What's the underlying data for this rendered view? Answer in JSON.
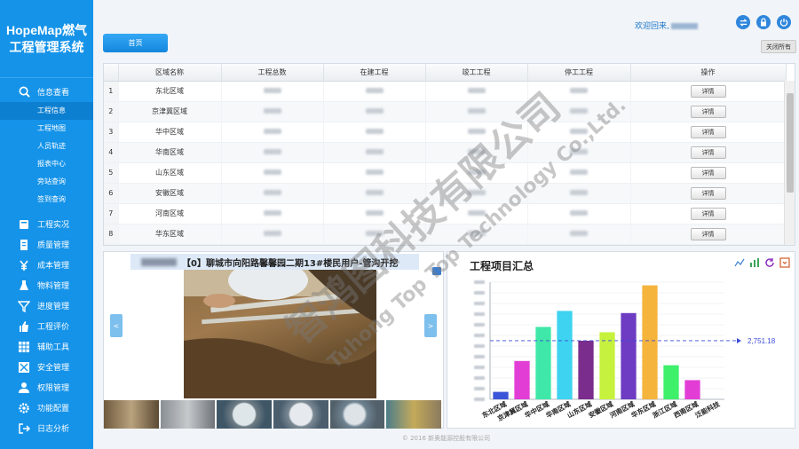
{
  "app": {
    "title_line1": "HopeMap燃气",
    "title_line2": "工程管理系统"
  },
  "sidebar": {
    "open_group": {
      "label": "信息查看",
      "icon": "search-icon"
    },
    "sub_items": [
      {
        "label": "工程信息",
        "active": true
      },
      {
        "label": "工程地图"
      },
      {
        "label": "人员轨迹"
      },
      {
        "label": "报表中心"
      },
      {
        "label": "旁站查询"
      },
      {
        "label": "签到查询"
      }
    ],
    "items": [
      {
        "label": "工程实况",
        "icon": "book-icon"
      },
      {
        "label": "质量管理",
        "icon": "document-icon"
      },
      {
        "label": "成本管理",
        "icon": "yen-icon"
      },
      {
        "label": "物料管理",
        "icon": "flask-icon"
      },
      {
        "label": "进度管理",
        "icon": "filter-icon"
      },
      {
        "label": "工程评价",
        "icon": "thumbs-up-icon"
      },
      {
        "label": "辅助工具",
        "icon": "grid-icon"
      },
      {
        "label": "安全管理",
        "icon": "shield-icon"
      },
      {
        "label": "权限管理",
        "icon": "user-icon"
      },
      {
        "label": "功能配置",
        "icon": "gear-icon"
      },
      {
        "label": "日志分析",
        "icon": "logout-icon"
      }
    ]
  },
  "header": {
    "home_tab": "首页",
    "welcome": "欢迎回来,",
    "close_all": "关闭所有"
  },
  "table": {
    "columns": [
      "区域名称",
      "工程总数",
      "在建工程",
      "竣工工程",
      "停工工程",
      "操作"
    ],
    "detail_label": "详情",
    "rows": [
      {
        "index": "1",
        "region": "东北区域"
      },
      {
        "index": "2",
        "region": "京津冀区域"
      },
      {
        "index": "3",
        "region": "华中区域"
      },
      {
        "index": "4",
        "region": "华南区域"
      },
      {
        "index": "5",
        "region": "山东区域"
      },
      {
        "index": "6",
        "region": "安徽区域"
      },
      {
        "index": "7",
        "region": "河南区域"
      },
      {
        "index": "8",
        "region": "华东区域"
      }
    ]
  },
  "photo_panel": {
    "title": "【0】聊城市向阳路馨馨园二期13#楼民用户-管沟开挖",
    "prev": "<",
    "next": ">"
  },
  "summary": {
    "title": "工程项目汇总"
  },
  "chart_data": {
    "type": "bar",
    "categories": [
      "东北区域",
      "京津冀区域",
      "华中区域",
      "华南区域",
      "山东区域",
      "安徽区域",
      "河南区域",
      "华东区域",
      "浙江区域",
      "西南区域",
      "泛能科技"
    ],
    "values": [
      350,
      1800,
      3400,
      4150,
      2750,
      3150,
      4050,
      5350,
      1600,
      900,
      0
    ],
    "colors": [
      "#3b55d9",
      "#e23ed6",
      "#3fe8a8",
      "#3ed3f0",
      "#7a2d8c",
      "#c6f23e",
      "#6e3cc2",
      "#f5b43c",
      "#3ef06a",
      "#e23ed6",
      "#3e6af0"
    ],
    "ylim": [
      0,
      5500
    ],
    "average": 2751.18,
    "average_label": "2,751.18",
    "grid": true
  },
  "footer": {
    "copyright": "© 2016 新奥能源控股有限公司"
  },
  "watermark": {
    "line1": "智鸿图科技有限公司",
    "line2": "Tuhong Top Top Technology Co.,Ltd."
  },
  "colors": {
    "sidebar": "#1593e9",
    "accent": "#2f86dc",
    "avg_line": "#3b4bd9"
  }
}
